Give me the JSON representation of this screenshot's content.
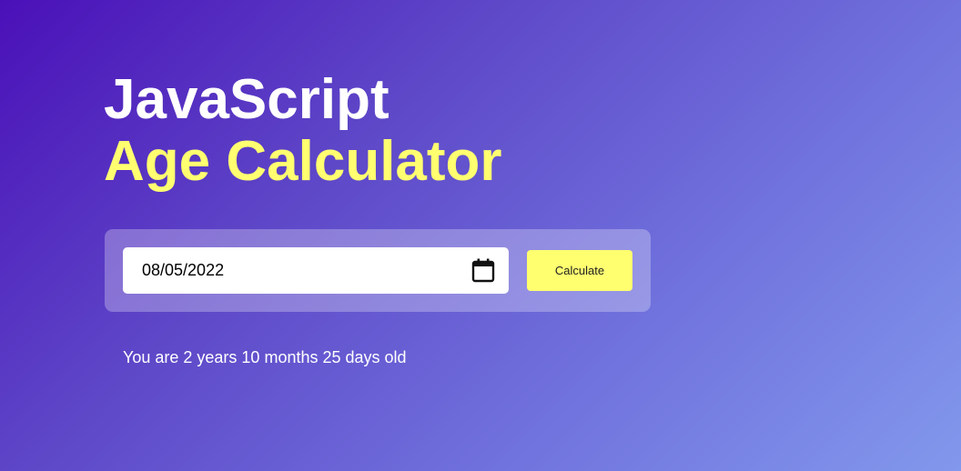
{
  "heading": {
    "line1": "JavaScript",
    "line2": "Age Calculator"
  },
  "form": {
    "date_value": "08/05/2022",
    "calendar_icon": "calendar-icon",
    "button_label": "Calculate"
  },
  "result": {
    "text": "You are 2 years 10 months 25 days old"
  },
  "colors": {
    "accent_yellow": "#ffff70",
    "text_white": "#ffffff",
    "gradient_start": "#4a10b8",
    "gradient_end": "#8298ec"
  }
}
